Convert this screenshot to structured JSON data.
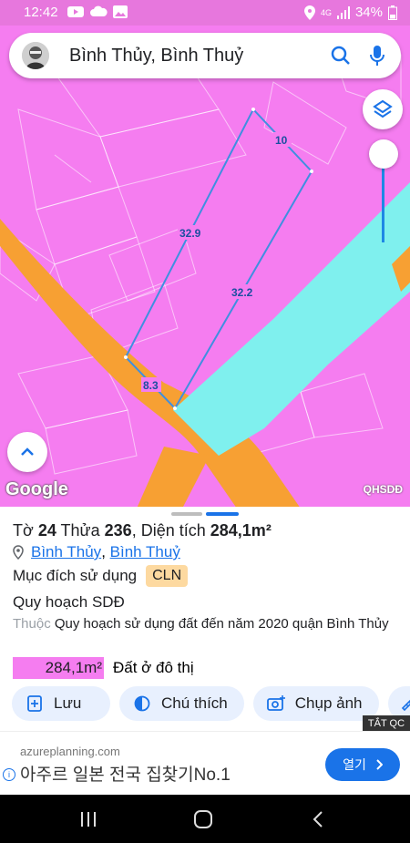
{
  "status_bar": {
    "time": "12:42",
    "network": "4G",
    "battery": "34%"
  },
  "search": {
    "text": "Bình Thủy, Bình Thuỷ"
  },
  "map": {
    "google_label": "Google",
    "layer_label": "QHSDĐ",
    "edge_labels": [
      "10",
      "32.9",
      "32.2",
      "8.3"
    ],
    "colors": {
      "land": "#f57df0",
      "water": "#7ff0ee",
      "road": "#f7a033",
      "boundary": "#3f8fe0"
    }
  },
  "parcel": {
    "title_prefix": "Tờ",
    "sheet": "24",
    "plot_label": "Thửa",
    "plot": "236",
    "area_label": "Diện tích",
    "area": "284,1m²",
    "district": "Bình Thủy",
    "ward": "Bình Thuỷ",
    "purpose_label": "Mục đích sử dụng",
    "purpose_code": "CLN",
    "planning_title": "Quy hoạch SDĐ",
    "belongs_label": "Thuộc",
    "planning_name": "Quy hoạch sử dụng đất đến năm 2020 quận Bình Thủy",
    "area_chip": "284,1m²",
    "area_chip_label": "Đất ở đô thị"
  },
  "actions": {
    "save": "Lưu",
    "legend": "Chú thích",
    "screenshot": "Chụp ảnh"
  },
  "ad": {
    "hide_label": "TẮT QC",
    "domain": "azureplanning.com",
    "text": "아주르 일본 전국 집찾기No.1",
    "button": "열기"
  }
}
